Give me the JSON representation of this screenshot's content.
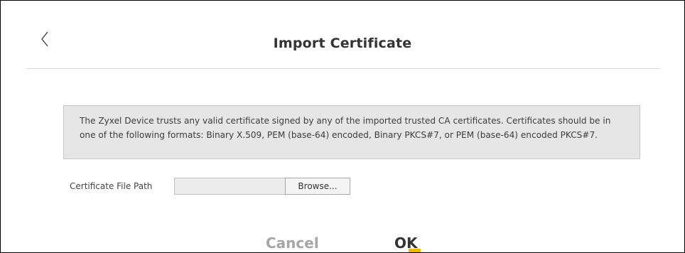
{
  "header": {
    "back_icon": "chevron-left-icon",
    "title": "Import Certificate"
  },
  "info": {
    "text": "The Zyxel Device trusts any valid certificate signed by any of the imported trusted CA certificates. Certificates should be in one of the following formats: Binary X.509, PEM (base-64) encoded, Binary PKCS#7, or PEM (base-64) encoded PKCS#7."
  },
  "form": {
    "file_path_label": "Certificate File Path",
    "file_path_value": "",
    "browse_label": "Browse..."
  },
  "footer": {
    "cancel_label": "Cancel",
    "ok_label": "OK"
  },
  "colors": {
    "accent": "#f5b800",
    "info_bg": "#e6e6e6",
    "cancel_text": "#a6a6a6"
  }
}
